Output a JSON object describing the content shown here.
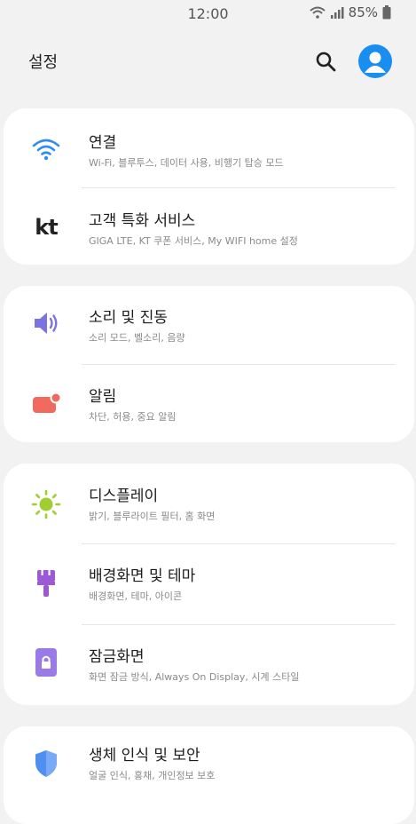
{
  "status_bar": {
    "time": "12:00",
    "battery": "85%"
  },
  "header": {
    "title": "설정"
  },
  "icons": {
    "search": "search-icon",
    "profile": "account-icon",
    "wifi": "wifi-icon",
    "kt": "kt-logo",
    "sound": "speaker-icon",
    "notification": "notification-icon",
    "display": "sun-icon",
    "wallpaper": "paintbrush-icon",
    "lockscreen": "lock-icon",
    "biometrics": "shield-icon"
  },
  "colors": {
    "accent_blue": "#1a8ef0",
    "wifi": "#2f8df2",
    "sound": "#7a74e0",
    "notification": "#f16a5e",
    "display": "#9fce30",
    "wallpaper": "#9b59d6",
    "lockscreen": "#9a7be6",
    "biometrics": "#4f8ff0"
  },
  "settings": [
    {
      "title": "연결",
      "subtitle": "Wi-Fi, 블루투스, 데이터 사용, 비행기 탑승 모드"
    },
    {
      "title": "고객 특화 서비스",
      "subtitle": "GIGA LTE, KT 쿠폰 서비스, My WIFI home 설정",
      "icon_text": "kt"
    },
    {
      "title": "소리 및 진동",
      "subtitle": "소리 모드, 벨소리, 음량"
    },
    {
      "title": "알림",
      "subtitle": "차단, 허용, 중요 알림"
    },
    {
      "title": "디스플레이",
      "subtitle": "밝기, 블루라이트 필터, 홈 화면"
    },
    {
      "title": "배경화면 및 테마",
      "subtitle": "배경화면, 테마, 아이콘"
    },
    {
      "title": "잠금화면",
      "subtitle": "화면 잠금 방식, Always On Display, 시계 스타일"
    },
    {
      "title": "생체 인식 및 보안",
      "subtitle": "얼굴 인식, 홍채, 개인정보 보호"
    }
  ]
}
